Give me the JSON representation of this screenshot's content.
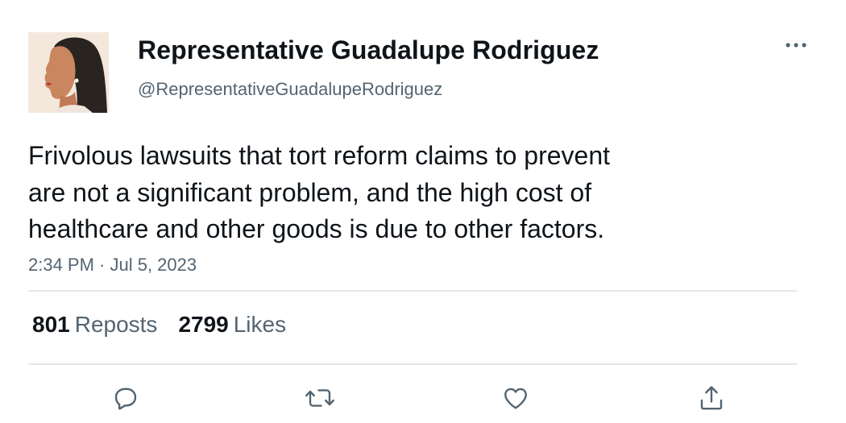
{
  "author": {
    "display_name": "Representative Guadalupe Rodriguez",
    "handle": "@RepresentativeGuadalupeRodriguez",
    "avatar_icon": "profile-photo-woman-in-profile"
  },
  "tweet": {
    "lines": [
      "Frivolous lawsuits that tort reform claims to prevent",
      "are not a significant problem, and the high cost of",
      "healthcare and other goods is due to other factors."
    ],
    "timestamp": "2:34 PM · Jul 5, 2023"
  },
  "stats": {
    "reposts_count": "801",
    "reposts_label": "Reposts",
    "likes_count": "2799",
    "likes_label": "Likes"
  },
  "actions": {
    "reply_icon": "reply-icon",
    "repost_icon": "repost-icon",
    "like_icon": "heart-icon",
    "share_icon": "share-icon"
  },
  "colors": {
    "text": "#0f1419",
    "secondary": "#536471",
    "divider": "#e1e6ea"
  }
}
